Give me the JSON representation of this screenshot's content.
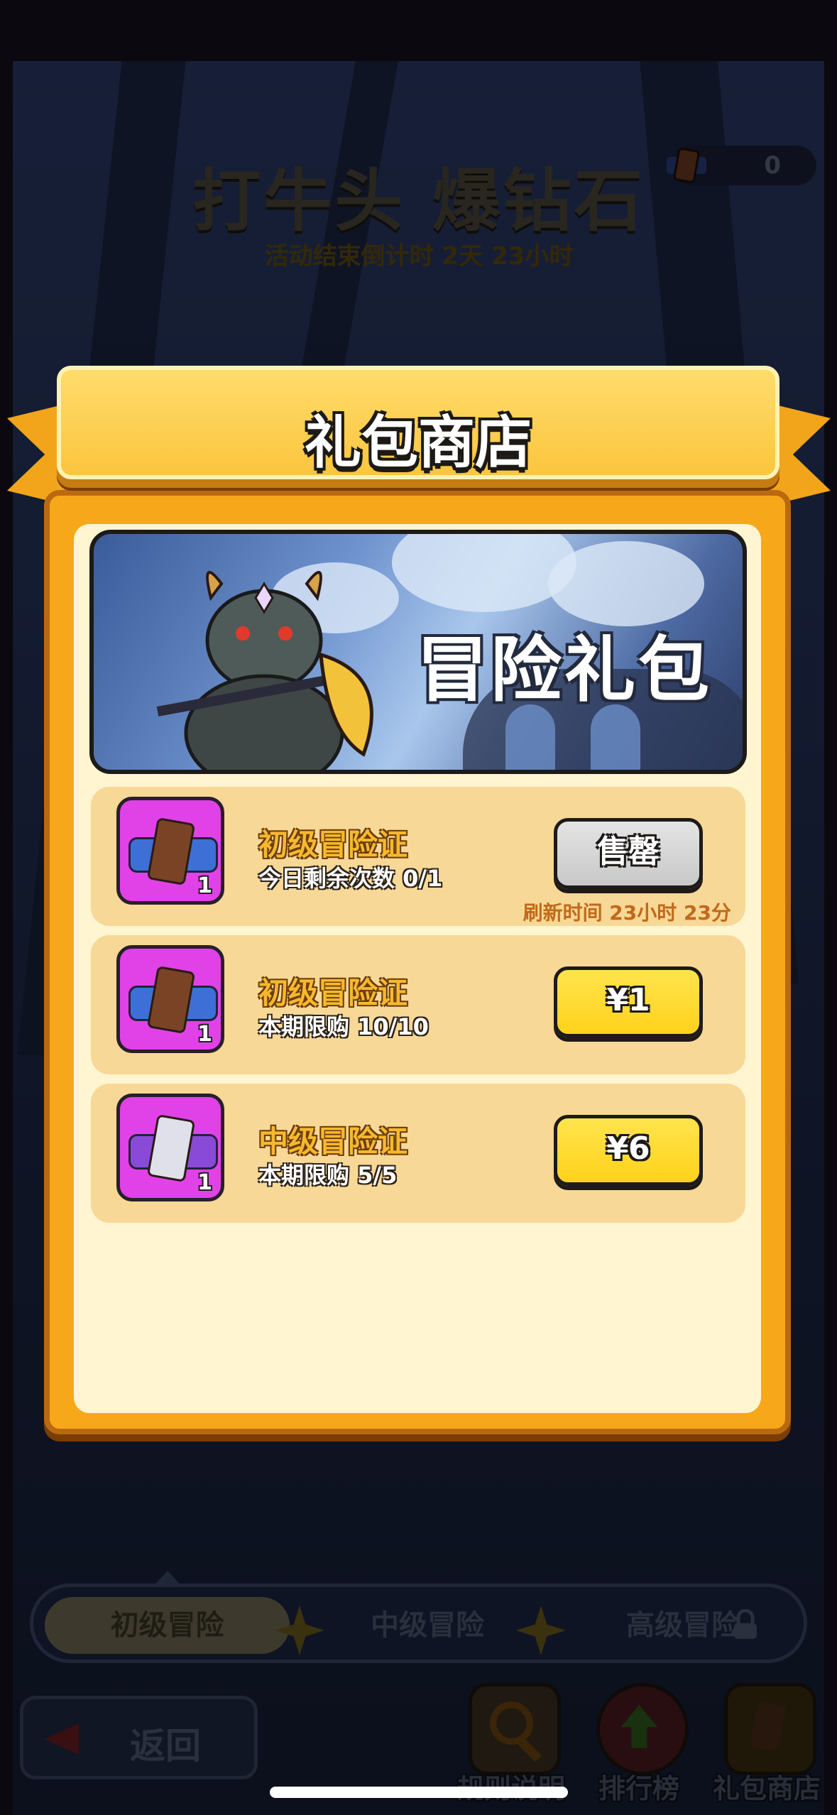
{
  "background": {
    "event_title": "打牛头 爆钻石",
    "countdown": "活动结束倒计时 2天 23小时",
    "ticket_count": "0"
  },
  "modal": {
    "title": "礼包商店",
    "banner_text": "冒险礼包",
    "items": [
      {
        "name": "初级冒险证",
        "sub": "今日剩余次数 0/1",
        "qty": "1",
        "button": "售罄",
        "button_state": "sold-out",
        "refresh": "刷新时间 23小时 23分"
      },
      {
        "name": "初级冒险证",
        "sub": "本期限购 10/10",
        "qty": "1",
        "button": "¥1",
        "button_state": "buy"
      },
      {
        "name": "中级冒险证",
        "sub": "本期限购 5/5",
        "qty": "1",
        "button": "¥6",
        "button_state": "buy"
      }
    ]
  },
  "tabs": [
    {
      "label": "初级冒险",
      "active": true
    },
    {
      "label": "中级冒险",
      "active": false
    },
    {
      "label": "高级冒险",
      "active": false,
      "locked": true
    }
  ],
  "bottom": {
    "back_label": "返回",
    "nav": [
      {
        "label": "规则说明",
        "icon": "magnifier-icon"
      },
      {
        "label": "排行榜",
        "icon": "rank-arrow-icon"
      },
      {
        "label": "礼包商店",
        "icon": "gift-ticket-icon"
      }
    ]
  },
  "colors": {
    "accent_gold": "#f6a81a",
    "panel_cream": "#fff5d1",
    "item_purple": "#e042e8",
    "buy_yellow": "#ffd21a"
  }
}
